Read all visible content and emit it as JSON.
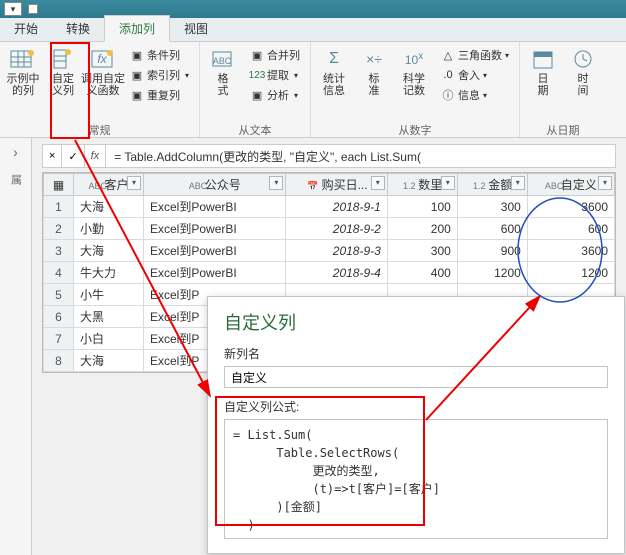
{
  "titlebar": {},
  "tabs": {
    "file": "开始",
    "t1": "转换",
    "t2": "添加列",
    "t3": "视图"
  },
  "ribbon": {
    "g0": {
      "b0": "示例中\n的列",
      "b1": "自定\n义列",
      "b2": "调用自定\n义函数",
      "c0": "条件列",
      "c1": "索引列",
      "c2": "重复列",
      "label": "常规"
    },
    "g1": {
      "b0": "格\n式",
      "c0": "合并列",
      "c1": "提取",
      "c2": "分析",
      "label": "从文本"
    },
    "g2": {
      "b0": "统计\n信息",
      "b1": "标\n准",
      "b2": "科学\n记数",
      "c0": "三角函数",
      "c1": "舍入",
      "c2": "信息",
      "label": "从数字"
    },
    "g3": {
      "b0": "日\n期",
      "b1": "时\n间",
      "label": "从日期"
    }
  },
  "fx": {
    "times": "×",
    "check": "✓",
    "fx": "fx",
    "formula": "= Table.AddColumn(更改的类型, \"自定义\", each List.Sum("
  },
  "grid": {
    "headers": [
      "",
      "客户",
      "公众号",
      "购买日...",
      "数里",
      "金额",
      "自定义"
    ],
    "typeicons": [
      "",
      "ABC",
      "ABC",
      "📅",
      "1.2",
      "1.2",
      "ABC"
    ],
    "rows": [
      {
        "n": 1,
        "c": "大海",
        "p": "Excel到PowerBI",
        "d": "2018-9-1",
        "q": "100",
        "a": "300",
        "s": "3600"
      },
      {
        "n": 2,
        "c": "小勤",
        "p": "Excel到PowerBI",
        "d": "2018-9-2",
        "q": "200",
        "a": "600",
        "s": "600"
      },
      {
        "n": 3,
        "c": "大海",
        "p": "Excel到PowerBI",
        "d": "2018-9-3",
        "q": "300",
        "a": "900",
        "s": "3600"
      },
      {
        "n": 4,
        "c": "牛大力",
        "p": "Excel到PowerBI",
        "d": "2018-9-4",
        "q": "400",
        "a": "1200",
        "s": "1200"
      },
      {
        "n": 5,
        "c": "小牛",
        "p": "Excel到P",
        "d": "",
        "q": "",
        "a": "",
        "s": ""
      },
      {
        "n": 6,
        "c": "大黑",
        "p": "Excel到P",
        "d": "",
        "q": "",
        "a": "",
        "s": ""
      },
      {
        "n": 7,
        "c": "小白",
        "p": "Excel到P",
        "d": "",
        "q": "",
        "a": "",
        "s": ""
      },
      {
        "n": 8,
        "c": "大海",
        "p": "Excel到P",
        "d": "",
        "q": "",
        "a": "",
        "s": ""
      }
    ]
  },
  "sidebar": {
    "label": "属"
  },
  "dialog": {
    "title": "自定义列",
    "name_label": "新列名",
    "name_value": "自定义",
    "formula_label": "自定义列公式:",
    "formula": "= List.Sum(\n      Table.SelectRows(\n           更改的类型,\n           (t)=>t[客户]=[客户]\n      )[金额]\n  )"
  }
}
